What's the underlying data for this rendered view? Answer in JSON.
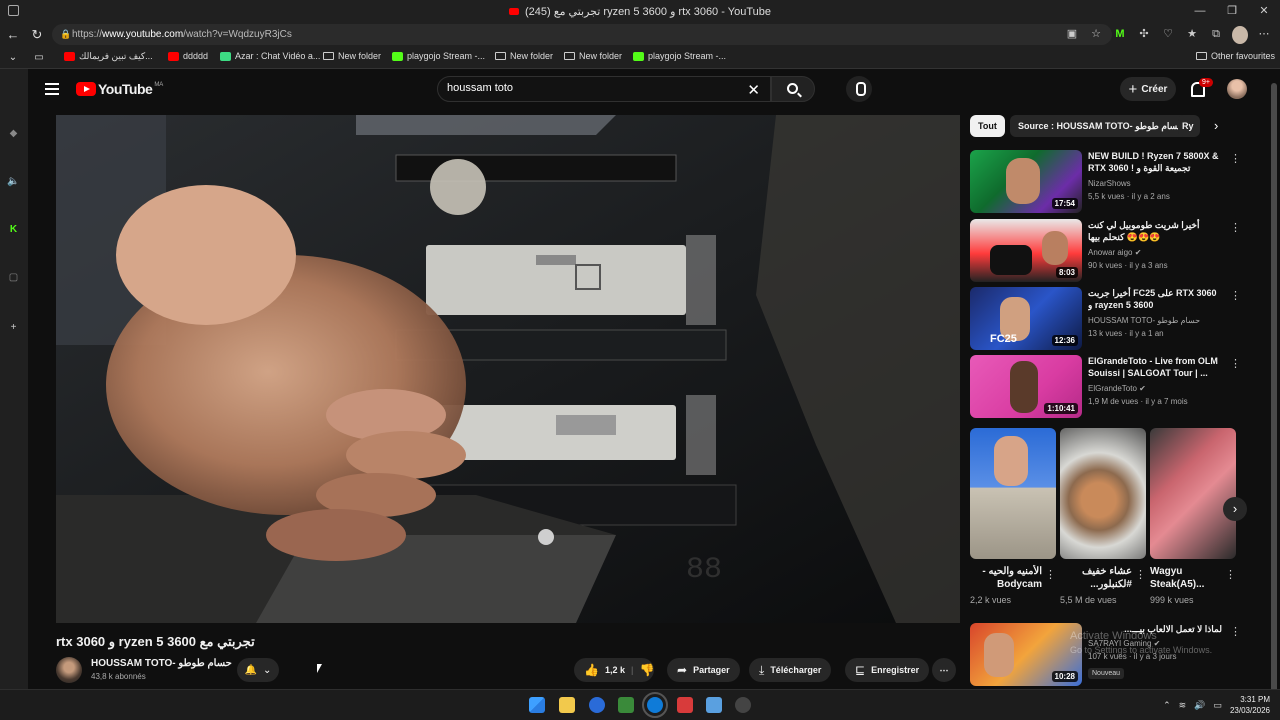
{
  "window": {
    "title": "(245) تجربتي مع ryzen 5 3600 و rtx 3060 - YouTube",
    "controls": [
      "—",
      "❐",
      "✕"
    ]
  },
  "browser": {
    "url_prefix": "https://",
    "url_host": "www.youtube.com",
    "url_path": "/watch?v=WqdzuyR3jCs",
    "bookmarks": [
      {
        "label": "كيف تبين فريمالك...",
        "color": "#ff0000",
        "type": "yt"
      },
      {
        "label": "ddddd",
        "color": "#ff0000",
        "type": "yt"
      },
      {
        "label": "Azar : Chat Vidéo a...",
        "color": "#3ddc84",
        "type": "app"
      },
      {
        "label": "New folder",
        "type": "folder"
      },
      {
        "label": "playgojo Stream -...",
        "color": "#53fc18",
        "type": "kick"
      },
      {
        "label": "New folder",
        "type": "folder"
      },
      {
        "label": "New folder",
        "type": "folder"
      },
      {
        "label": "playgojo Stream -...",
        "color": "#53fc18",
        "type": "kick"
      }
    ],
    "other_favorites": "Other favourites"
  },
  "youtube": {
    "logo_text": "YouTube",
    "logo_region": "MA",
    "search_value": "houssam toto",
    "create_label": "Créer",
    "notification_count": "9+"
  },
  "video": {
    "title": "تجربتي مع ryzen 5 3600 و rtx 3060",
    "channel": "HOUSSAM TOTO- حسام طوطو",
    "subscribers": "43,8 k abonnés",
    "likes": "1,2 k",
    "share_label": "Partager",
    "download_label": "Télécharger",
    "save_label": "Enregistrer",
    "more_label": "⋯"
  },
  "chips": [
    "Tout",
    "Source : HOUSSAM TOTO- حسام طوطو",
    "Ry"
  ],
  "recommendations": [
    {
      "title": "NEW BUILD ! Ryzen 7 5800X & RTX 3060 ! تجميعة القوة و الإقتصاد",
      "channel": "NizarShows",
      "meta": "5,5 k vues · il y a 2 ans",
      "duration": "17:54",
      "verified": false
    },
    {
      "title": "أخيرا شريت طوموبيل لي كنت كنحلم بيها 😍😍😍",
      "channel": "Anowar aigo",
      "meta": "90 k vues · il y a 3 ans",
      "duration": "8:03",
      "verified": true
    },
    {
      "title": "أخيرا جربت FC25 على RTX 3060 و rayzen 5 3600",
      "channel": "HOUSSAM TOTO- حسام طوطو",
      "meta": "13 k vues · il y a 1 an",
      "duration": "12:36",
      "verified": false
    },
    {
      "title": "ElGrandeToto  - Live from OLM Souissi | SALGOAT Tour | ...",
      "channel": "ElGrandeToto",
      "meta": "1,9 M de vues · il y a 7 mois",
      "duration": "1:10:41",
      "verified": true
    }
  ],
  "shorts": [
    {
      "title": "الأمنيه والحيه - Bodycam",
      "views": "2,2 k vues"
    },
    {
      "title": "عشاء خفيف #لكنبلور...",
      "views": "5,5 M de vues"
    },
    {
      "title": "Wagyu Steak(A5)...",
      "views": "999 k vues"
    }
  ],
  "last_rec": {
    "title": "لماذا لا تعمل الالعاب بيـــ...",
    "channel": "SA7RAYI Gaming",
    "meta": "107 k vues · il y a 3 jours",
    "duration": "10:28",
    "badge": "Nouveau"
  },
  "watermark": {
    "line1": "Activate Windows",
    "line2": "Go to Settings to activate Windows."
  },
  "taskbar": {
    "time": "3:31 PM",
    "date": "23/03/2026"
  }
}
